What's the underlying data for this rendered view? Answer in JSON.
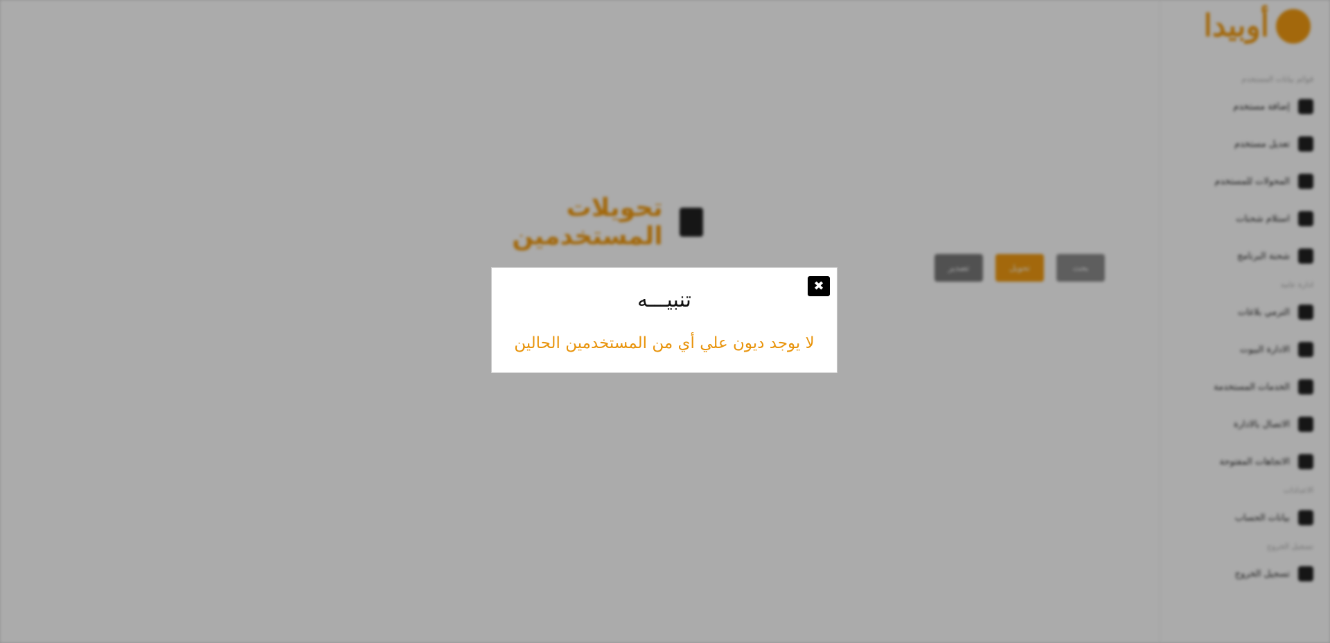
{
  "sidebar": {
    "logo_text": "أوبيدا",
    "section_1": "قوائم بيانات المستخدم",
    "items_1": [
      {
        "label": "إضافة مستخدم"
      },
      {
        "label": "تعديل مستخدم"
      },
      {
        "label": "المحولات للمستخدم"
      },
      {
        "label": "استلام شحنات"
      },
      {
        "label": "شحنة البرنامج"
      }
    ],
    "section_2": "ادارة عامة",
    "items_2": [
      {
        "label": "الترمي بلاغات"
      },
      {
        "label": "الادارة البيوت"
      },
      {
        "label": "الخدمات المستخدمة"
      },
      {
        "label": "الاتصال بالادارة"
      },
      {
        "label": "الاتجاهات المفتوحة"
      }
    ],
    "section_3": "الاعدادات",
    "items_3": [
      {
        "label": "بيانات الحساب"
      }
    ],
    "section_4": "تسجيل الخروج",
    "items_4": [
      {
        "label": "تسجيل الخروج"
      }
    ]
  },
  "main": {
    "title": "تحويلات المستخدمين",
    "buttons": [
      {
        "label": "بحث"
      },
      {
        "label": "تحويل"
      },
      {
        "label": "تصدير"
      }
    ]
  },
  "modal": {
    "close_glyph": "✖",
    "title": "تنبيـــه",
    "message": "لا يوجد ديون علي أي من المستخدمين الحالين"
  },
  "colors": {
    "accent": "#f39c12",
    "message_text": "#e8930a",
    "overlay": "rgba(0,0,0,0.33)"
  }
}
